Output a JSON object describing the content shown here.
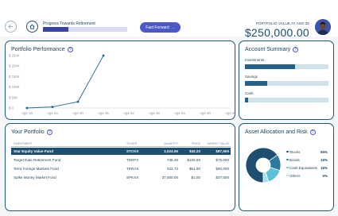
{
  "header": {
    "progress_label": "Progress Towards Retirement",
    "progress_fraction": 0.3,
    "fast_forward_label": "Fast Forward",
    "fast_forward_arrow": "→",
    "portfolio_label": "PORTFOLIO VALUE AT AGE 36",
    "portfolio_value": "$250,000.00",
    "icons": {
      "back": "arrow-left-icon",
      "home": "home-icon"
    }
  },
  "performance": {
    "title": "Portfolio Performance",
    "chart_data": {
      "type": "line",
      "title": "Portfolio Performance",
      "x": [
        "Age 18",
        "Age 24",
        "Age 30",
        "Age 36",
        "Age 42",
        "Age 48",
        "Age 54",
        "Age 60",
        "Age 66"
      ],
      "series": [
        {
          "values": [
            0,
            5000,
            30000,
            250000
          ]
        }
      ],
      "ylim": [
        0,
        250000
      ],
      "yticks": [
        "$ 0",
        "$ 50K",
        "$ 100K",
        "$ 150K",
        "$ 200K",
        "$ 250K"
      ],
      "color": "#2b6f99",
      "grid": false
    }
  },
  "account_summary": {
    "title": "Account Summary",
    "items": [
      {
        "label": "Investments",
        "fraction": 0.6
      },
      {
        "label": "Savings",
        "fraction": 0.27
      },
      {
        "label": "Cash",
        "fraction": 0.04
      }
    ]
  },
  "portfolio": {
    "title": "Your Portfolio",
    "columns": [
      "INVESTMENT",
      "TICKER",
      "QUANTITY",
      "PRICE",
      "MARKET VALUE"
    ],
    "rows": [
      {
        "investment": "Star Equity Value Fund",
        "ticker": "STCKX",
        "quantity": "2,024.06",
        "price": "$43.23",
        "market_value": "$87,500",
        "selected": true
      },
      {
        "investment": "Target Date Retirement Fund",
        "ticker": "TDRFX",
        "quantity": "748.29",
        "price": "$100.50",
        "market_value": "$75,000",
        "selected": false
      },
      {
        "investment": "Terra Foreign Markets Fund",
        "ticker": "TERAX",
        "quantity": "811.72",
        "price": "$61.60",
        "market_value": "$50,000",
        "selected": false
      },
      {
        "investment": "Spike Money Market Fund",
        "ticker": "SPKXX",
        "quantity": "37,500.00",
        "price": "$1.00",
        "market_value": "$37,500",
        "selected": false
      }
    ]
  },
  "allocation": {
    "title": "Asset Allocation and Risk",
    "chart_data": {
      "type": "pie",
      "categories": [
        "Stocks",
        "Bonds",
        "Cash Equivalents",
        "Others"
      ],
      "values": [
        65,
        15,
        15,
        5
      ],
      "labels": [
        "65%",
        "15%",
        "15%",
        "5%"
      ],
      "colors": [
        "#1d4f70",
        "#2e7a9e",
        "#5cc0da",
        "#a9dde9"
      ]
    }
  }
}
